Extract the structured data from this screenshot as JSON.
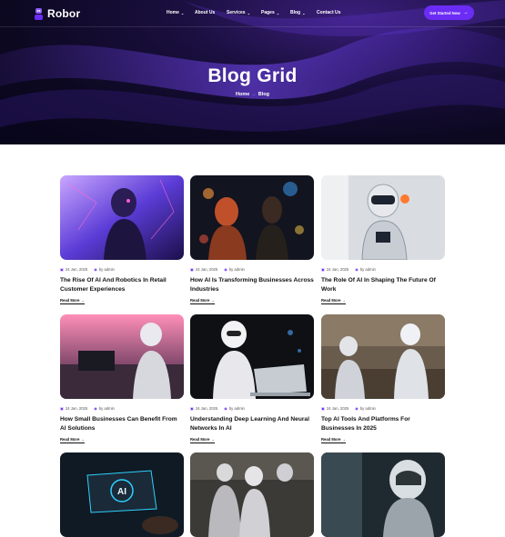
{
  "brand": {
    "name": "Robor",
    "accent": "#6b2cf5"
  },
  "nav": {
    "items": [
      {
        "label": "Home",
        "has_dropdown": true
      },
      {
        "label": "About Us",
        "has_dropdown": false
      },
      {
        "label": "Services",
        "has_dropdown": true
      },
      {
        "label": "Pages",
        "has_dropdown": true
      },
      {
        "label": "Blog",
        "has_dropdown": true
      },
      {
        "label": "Contact Us",
        "has_dropdown": false
      }
    ],
    "cta_label": "Get Started Now"
  },
  "hero": {
    "title": "Blog Grid",
    "breadcrumb": [
      "Home",
      "Blog"
    ]
  },
  "posts": [
    {
      "date": "24 Jan, 2025",
      "author": "by admin",
      "title": "The Rise Of AI And Robotics In Retail Customer Experiences",
      "more": "Read More",
      "image": "neon-cyborg-woman"
    },
    {
      "date": "24 Jan, 2025",
      "author": "by admin",
      "title": "How AI Is Transforming Businesses Across Industries",
      "more": "Read More",
      "image": "robot-woman-city-lights"
    },
    {
      "date": "24 Jan, 2025",
      "author": "by admin",
      "title": "The Role Of AI In Shaping The Future Of Work",
      "more": "Read More",
      "image": "robot-ai-chest"
    },
    {
      "date": "24 Jan, 2025",
      "author": "by admin",
      "title": "How Small Businesses Can Benefit From AI Solutions",
      "more": "Read More",
      "image": "robot-at-desk-pink"
    },
    {
      "date": "24 Jan, 2025",
      "author": "by admin",
      "title": "Understanding Deep Learning And Neural Networks In AI",
      "more": "Read More",
      "image": "robot-laptop-white"
    },
    {
      "date": "24 Jan, 2025",
      "author": "by admin",
      "title": "Top AI Tools And Platforms For Businesses In 2025",
      "more": "Read More",
      "image": "robots-office"
    },
    {
      "date": "",
      "author": "",
      "title": "",
      "more": "",
      "image": "ai-laptop-hands"
    },
    {
      "date": "",
      "author": "",
      "title": "",
      "more": "",
      "image": "robot-crowd"
    },
    {
      "date": "",
      "author": "",
      "title": "",
      "more": "",
      "image": "robot-helmet-profile"
    }
  ]
}
